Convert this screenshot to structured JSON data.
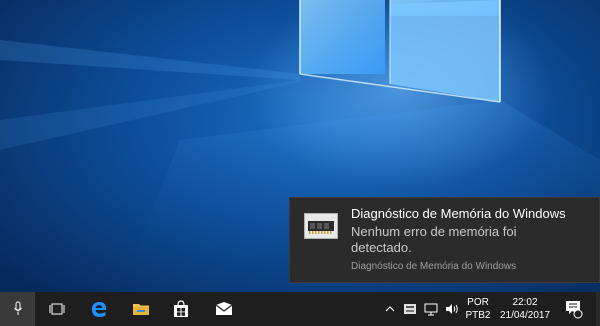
{
  "notification": {
    "title": "Diagnóstico de Memória do Windows",
    "body": "Nenhum erro de memória foi detectado.",
    "source": "Diagnóstico de Memória do Windows",
    "icon": "memory-chip-icon"
  },
  "taskbar": {
    "icons": [
      "microphone-icon",
      "task-view-icon",
      "edge-icon",
      "file-explorer-icon",
      "store-icon",
      "mail-icon"
    ],
    "tray": {
      "language_line1": "POR",
      "language_line2": "PTB2",
      "time": "22:02",
      "date": "21/04/2017",
      "notification_count": "1"
    }
  },
  "colors": {
    "taskbar": "#1e1e1e",
    "toast": "#2b2b2b",
    "accent": "#0078d7"
  }
}
